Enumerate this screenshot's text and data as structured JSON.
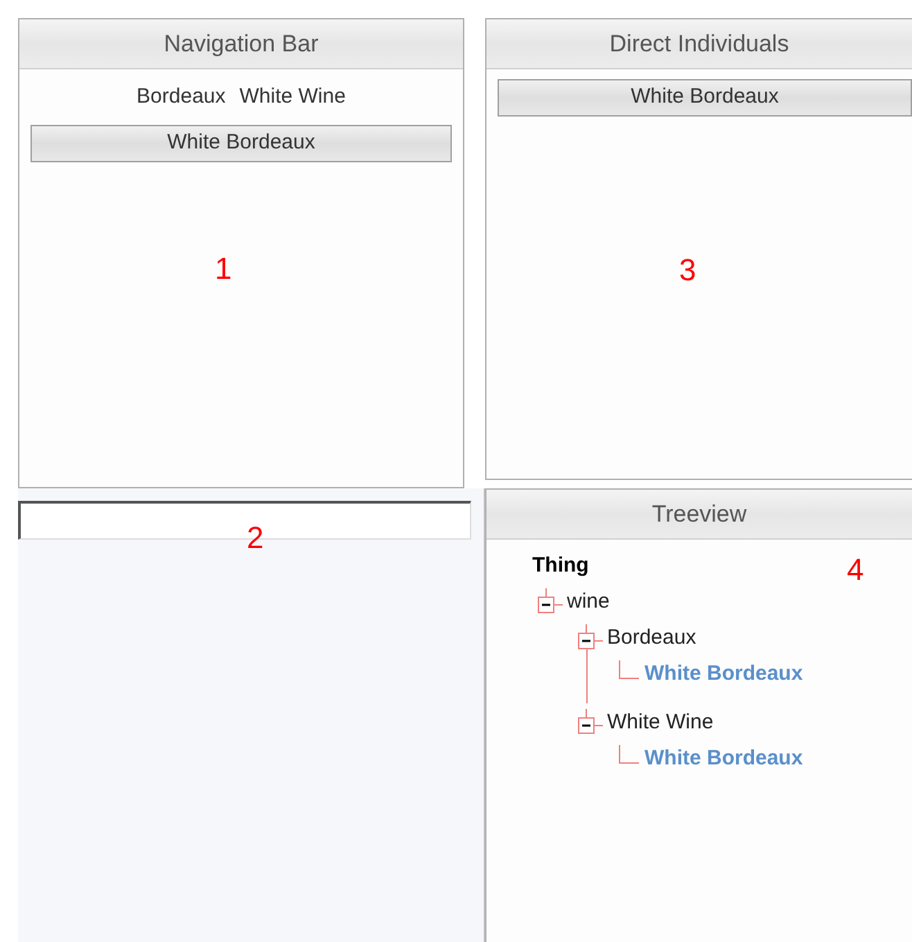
{
  "navigation_bar": {
    "title": "Navigation Bar",
    "breadcrumbs": [
      "Bordeaux",
      "White Wine"
    ],
    "buttons": [
      "White Bordeaux"
    ],
    "marker": "1"
  },
  "search_field": {
    "marker": "2"
  },
  "direct_individuals": {
    "title": "Direct Individuals",
    "buttons": [
      "White Bordeaux"
    ],
    "marker": "3"
  },
  "treeview": {
    "title": "Treeview",
    "marker": "4",
    "tree": [
      {
        "label": "Thing",
        "kind": "root",
        "children": [
          {
            "label": "wine",
            "kind": "class",
            "expanded": true,
            "children": [
              {
                "label": "Bordeaux",
                "kind": "class",
                "expanded": true,
                "children": [
                  {
                    "label": "White Bordeaux",
                    "kind": "individual"
                  }
                ]
              },
              {
                "label": "White Wine",
                "kind": "class",
                "expanded": true,
                "children": [
                  {
                    "label": "White Bordeaux",
                    "kind": "individual"
                  }
                ]
              }
            ]
          }
        ]
      }
    ]
  }
}
